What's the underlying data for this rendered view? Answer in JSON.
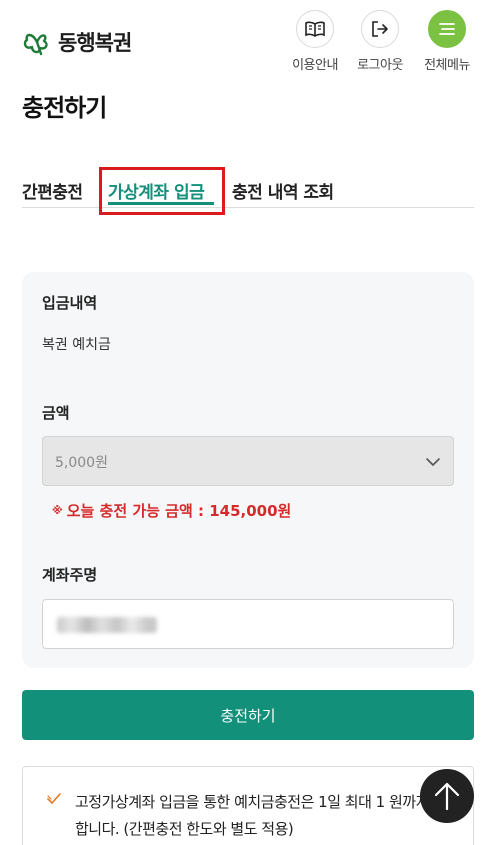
{
  "header": {
    "logo_text": "동행복권",
    "buttons": [
      {
        "label": "이용안내",
        "icon": "book-icon"
      },
      {
        "label": "로그아웃",
        "icon": "logout-icon"
      },
      {
        "label": "전체메뉴",
        "icon": "menu-icon"
      }
    ],
    "menu_color": "#7cc242"
  },
  "page_title": "충전하기",
  "tabs": [
    {
      "label": "간편충전",
      "active": false
    },
    {
      "label": "가상계좌 입금",
      "active": true
    },
    {
      "label": "충전 내역 조회",
      "active": false
    }
  ],
  "form": {
    "deposit_label": "입금내역",
    "deposit_value": "복권 예치금",
    "amount_label": "금액",
    "amount_selected": "5,000원",
    "notice_star": "※",
    "notice_text": "오늘 충전 가능 금액 : 145,000원",
    "account_label": "계좌주명",
    "account_value_obscured": true
  },
  "submit_label": "충전하기",
  "info": {
    "text": "고정가상계좌 입금을 통한 예치금충전은 1일 최대 1 원까지 가능합니다. (간편충전 한도와 별도 적용)"
  },
  "colors": {
    "accent": "#13907a",
    "highlight": "#d91b1b",
    "notice": "#d62a2a",
    "check": "#e87722"
  }
}
